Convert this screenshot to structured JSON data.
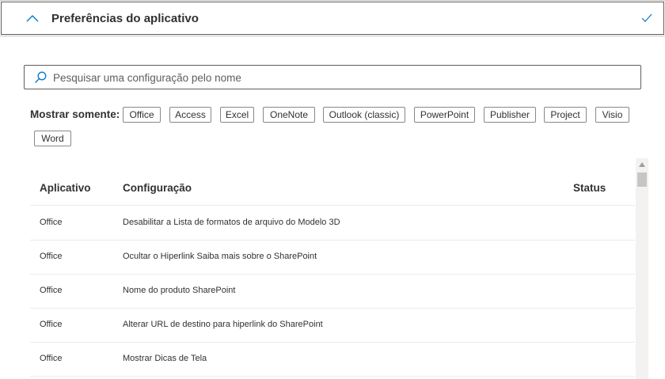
{
  "section": {
    "title": "Preferências do aplicativo"
  },
  "search": {
    "placeholder": "Pesquisar uma configuração pelo nome"
  },
  "filter": {
    "label": "Mostrar somente:",
    "chips": [
      "Office",
      "Access",
      "Excel",
      "OneNote",
      "Outlook (classic)",
      "PowerPoint",
      "Publisher",
      "Project",
      "Visio",
      "Word"
    ]
  },
  "table": {
    "headers": {
      "app": "Aplicativo",
      "config": "Configuração",
      "status": "Status"
    },
    "rows": [
      {
        "app": "Office",
        "config": "Desabilitar a Lista de formatos de arquivo do Modelo 3D",
        "status": ""
      },
      {
        "app": "Office",
        "config": "Ocultar o Hiperlink Saiba mais sobre o SharePoint",
        "status": ""
      },
      {
        "app": "Office",
        "config": "Nome do produto SharePoint",
        "status": ""
      },
      {
        "app": "Office",
        "config": "Alterar URL de destino para hiperlink do SharePoint",
        "status": ""
      },
      {
        "app": "Office",
        "config": "Mostrar Dicas de Tela",
        "status": ""
      }
    ]
  },
  "colors": {
    "accent": "#0078d4",
    "border": "#605e5c",
    "row_divider": "#edebe9"
  },
  "icons": {
    "collapse": "chevron-up-icon",
    "done": "checkmark-icon",
    "search": "search-icon"
  }
}
